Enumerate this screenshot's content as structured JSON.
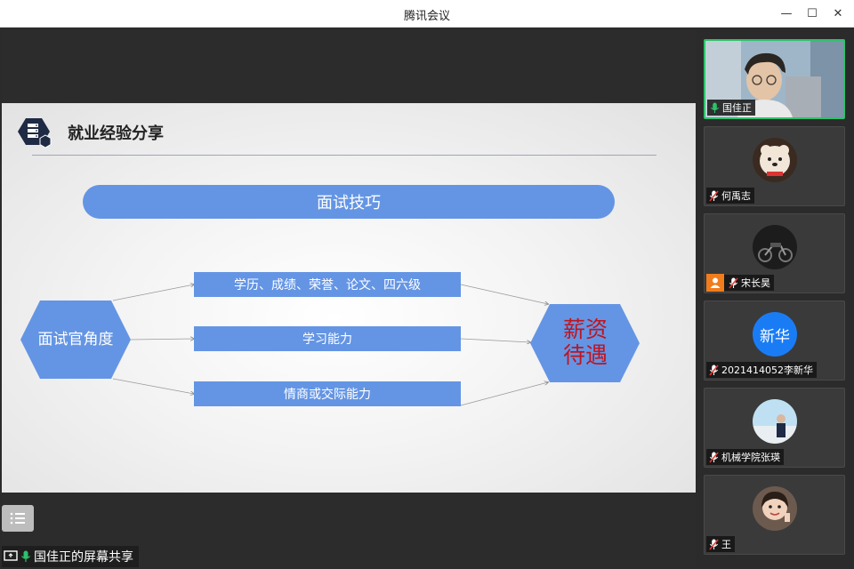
{
  "window": {
    "title": "腾讯会议",
    "minimize": "—",
    "maximize": "☐",
    "close": "✕"
  },
  "slide": {
    "title": "就业经验分享",
    "pill": "面试技巧",
    "left_hex": "面试官角度",
    "right_hex_line1": "薪资",
    "right_hex_line2": "待遇",
    "items": [
      "学历、成绩、荣誉、论文、四六级",
      "学习能力",
      "情商或交际能力"
    ],
    "colors": {
      "blue": "#6495e4",
      "red": "#c0141e",
      "navy": "#1f2a44"
    }
  },
  "share": {
    "label": "国佳正的屏幕共享"
  },
  "participants": [
    {
      "name": "国佳正",
      "mic": "mic-on",
      "type": "video"
    },
    {
      "name": "何禹志",
      "mic": "mic-muted",
      "type": "photo"
    },
    {
      "name": "宋长昊",
      "mic": "mic-muted",
      "type": "photo",
      "host": true
    },
    {
      "name": "2021414052李新华",
      "mic": "mic-muted",
      "type": "text",
      "avatar_text": "新华"
    },
    {
      "name": "机械学院张瑛",
      "mic": "mic-muted",
      "type": "photo"
    },
    {
      "name": "王",
      "mic": "mic-muted",
      "type": "photo"
    }
  ]
}
